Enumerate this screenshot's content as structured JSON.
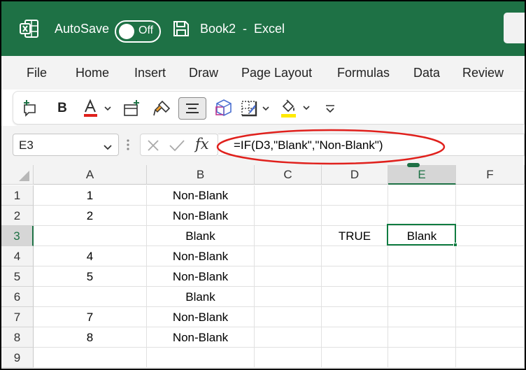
{
  "titlebar": {
    "autosave_label": "AutoSave",
    "autosave_state": "Off",
    "document_title": "Book2  -  Excel",
    "bg_color": "#1e7145"
  },
  "menu": {
    "items": [
      "File",
      "Home",
      "Insert",
      "Draw",
      "Page Layout",
      "Formulas",
      "Data",
      "Review"
    ]
  },
  "toolbar": {
    "bold_label": "B",
    "font_color": "#e0201c",
    "highlight_color": "#ffea00",
    "icons": [
      "new-comment-icon",
      "bold-icon",
      "font-color-icon",
      "insert-cells-icon",
      "format-painter-icon",
      "align-center-icon",
      "shapes-icon",
      "borders-icon",
      "fill-color-icon",
      "more-options-icon"
    ]
  },
  "formula_bar": {
    "name_box": "E3",
    "fx_label": "fx",
    "formula": "=IF(D3,\"Blank\",\"Non-Blank\")",
    "highlight_color": "#e0201c"
  },
  "grid": {
    "columns": [
      "A",
      "B",
      "C",
      "D",
      "E",
      "F"
    ],
    "rows": [
      {
        "num": "1",
        "cells": [
          "1",
          "Non-Blank",
          "",
          "",
          "",
          ""
        ]
      },
      {
        "num": "2",
        "cells": [
          "2",
          "Non-Blank",
          "",
          "",
          "",
          ""
        ]
      },
      {
        "num": "3",
        "cells": [
          "",
          "Blank",
          "",
          "TRUE",
          "Blank",
          ""
        ]
      },
      {
        "num": "4",
        "cells": [
          "4",
          "Non-Blank",
          "",
          "",
          "",
          ""
        ]
      },
      {
        "num": "5",
        "cells": [
          "5",
          "Non-Blank",
          "",
          "",
          "",
          ""
        ]
      },
      {
        "num": "6",
        "cells": [
          "",
          "Blank",
          "",
          "",
          "",
          ""
        ]
      },
      {
        "num": "7",
        "cells": [
          "7",
          "Non-Blank",
          "",
          "",
          "",
          ""
        ]
      },
      {
        "num": "8",
        "cells": [
          "8",
          "Non-Blank",
          "",
          "",
          "",
          ""
        ]
      },
      {
        "num": "9",
        "cells": [
          "",
          "",
          "",
          "",
          "",
          ""
        ]
      }
    ],
    "active_cell": "E3",
    "selection_color": "#107c41"
  }
}
